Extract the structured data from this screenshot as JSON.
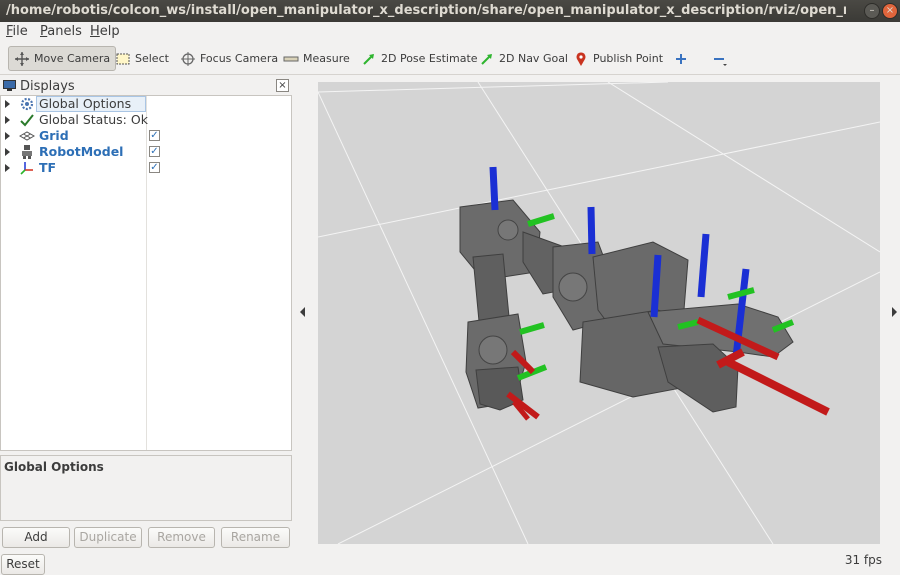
{
  "window": {
    "title": "/home/robotis/colcon_ws/install/open_manipulator_x_description/share/open_manipulator_x_description/rviz/open_manipulator_x.rviz -..."
  },
  "menu": {
    "items": [
      {
        "label": "File",
        "mnemonic": "F",
        "rest": "ile"
      },
      {
        "label": "Panels",
        "mnemonic": "P",
        "rest": "anels"
      },
      {
        "label": "Help",
        "mnemonic": "H",
        "rest": "elp"
      }
    ]
  },
  "toolbar": {
    "move_camera": "Move Camera",
    "select": "Select",
    "focus_camera": "Focus Camera",
    "measure": "Measure",
    "pose_estimate": "2D Pose Estimate",
    "nav_goal": "2D Nav Goal",
    "publish_point": "Publish Point"
  },
  "displays": {
    "title": "Displays",
    "items": [
      {
        "label": "Global Options",
        "icon": "gear-icon",
        "style": "normal",
        "checked": null
      },
      {
        "label": "Global Status: Ok",
        "icon": "check-icon",
        "style": "normal",
        "checked": null
      },
      {
        "label": "Grid",
        "icon": "grid-icon",
        "style": "blue",
        "checked": true
      },
      {
        "label": "RobotModel",
        "icon": "robot-icon",
        "style": "blue",
        "checked": true
      },
      {
        "label": "TF",
        "icon": "axes-icon",
        "style": "blue",
        "checked": true
      }
    ]
  },
  "properties": {
    "title": "Global Options"
  },
  "buttons": {
    "add": "Add",
    "duplicate": "Duplicate",
    "remove": "Remove",
    "rename": "Rename",
    "reset": "Reset"
  },
  "status": {
    "fps": "31 fps"
  },
  "colors": {
    "viewport_bg": "#d4d4d4",
    "axis_x": "#c21a1a",
    "axis_y": "#22c222",
    "axis_z": "#1a2fd4",
    "robot": "#6d6d6d"
  }
}
